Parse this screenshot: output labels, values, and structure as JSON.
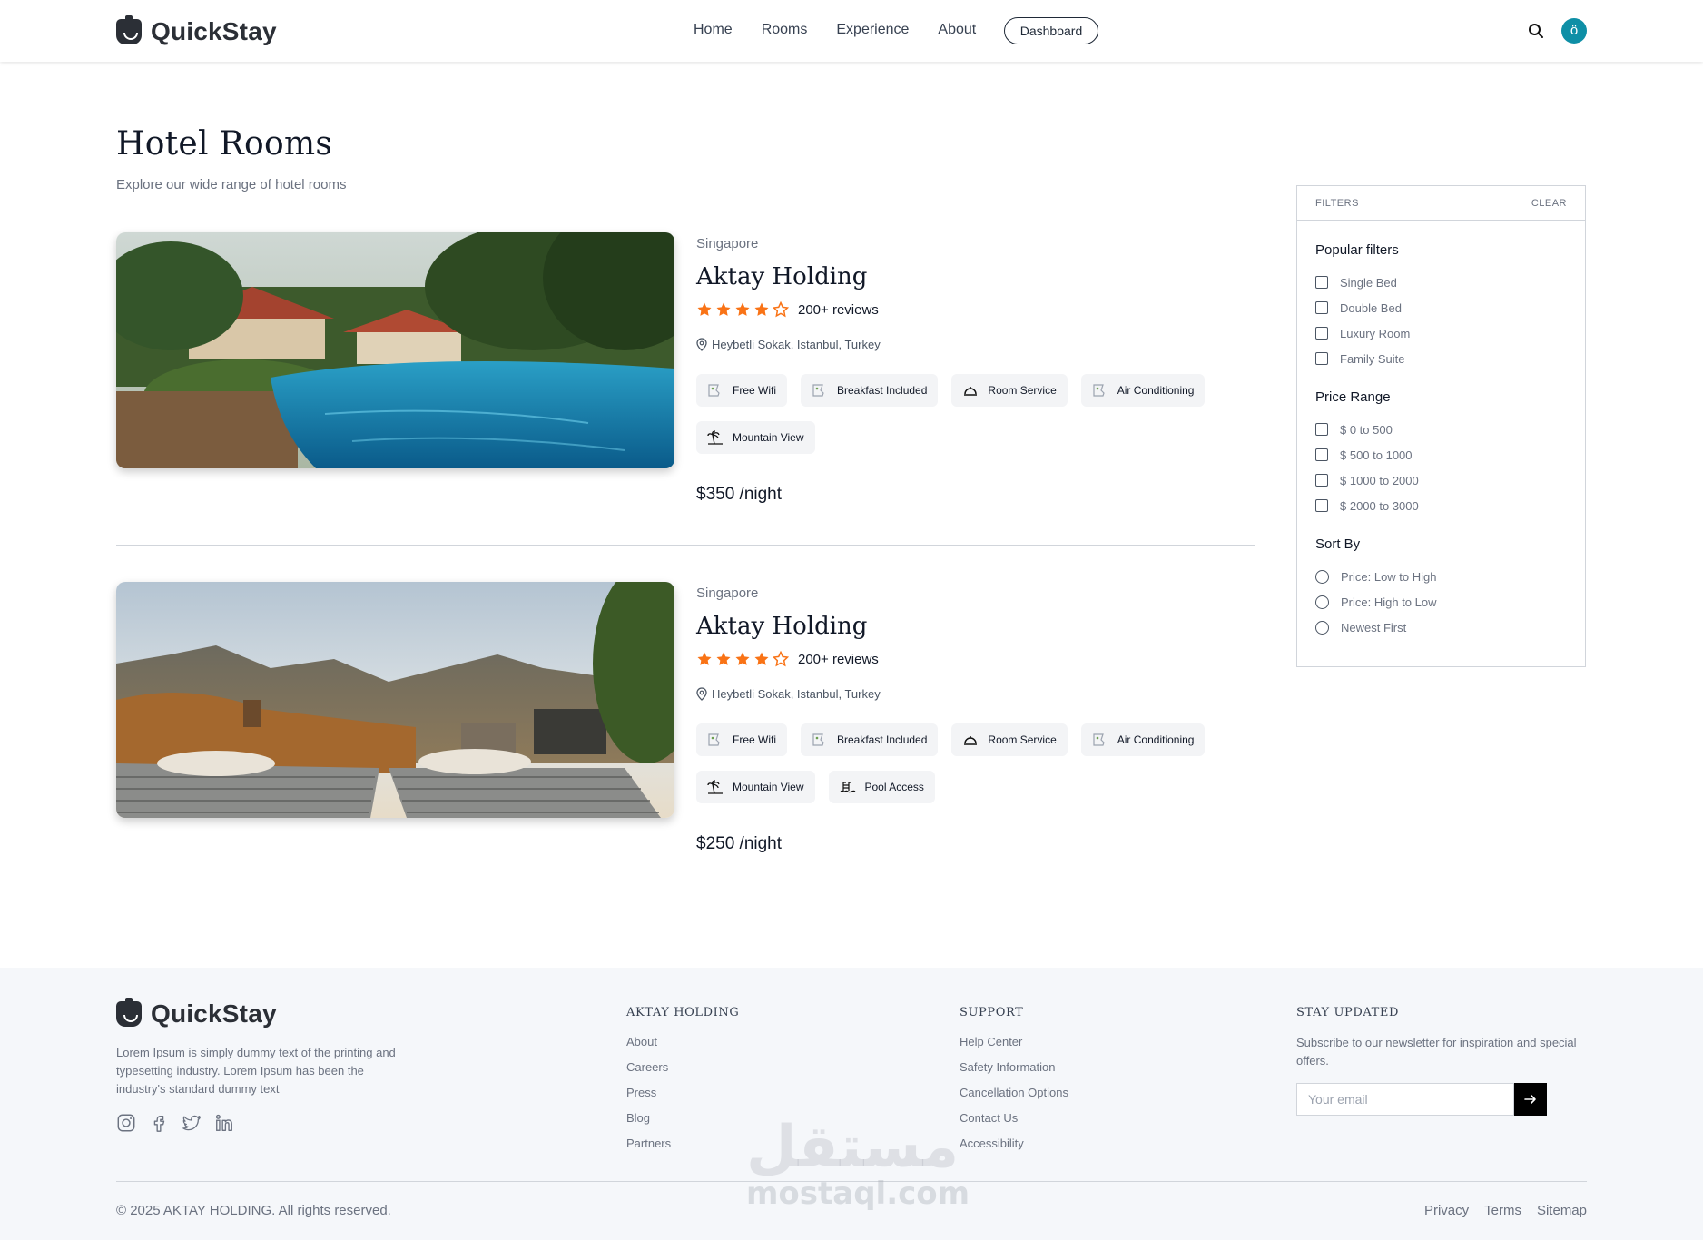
{
  "brand": {
    "name": "QuickStay"
  },
  "nav": {
    "links": [
      "Home",
      "Rooms",
      "Experience",
      "About"
    ],
    "dashboard_label": "Dashboard",
    "avatar_letter": "ö"
  },
  "page": {
    "title": "Hotel Rooms",
    "subtitle": "Explore our wide range of hotel rooms"
  },
  "rooms": [
    {
      "city": "Singapore",
      "name": "Aktay Holding",
      "rating": 4,
      "rating_max": 5,
      "reviews": "200+ reviews",
      "address": "Heybetli Sokak, Istanbul, Turkey",
      "amenities": [
        {
          "label": "Free Wifi",
          "icon": "broken-image-icon"
        },
        {
          "label": "Breakfast Included",
          "icon": "broken-image-icon"
        },
        {
          "label": "Room Service",
          "icon": "bell-icon"
        },
        {
          "label": "Air Conditioning",
          "icon": "broken-image-icon"
        },
        {
          "label": "Mountain View",
          "icon": "palm-tree-icon"
        }
      ],
      "price": "$350 /night",
      "image": "resort-pool-photo"
    },
    {
      "city": "Singapore",
      "name": "Aktay Holding",
      "rating": 4,
      "rating_max": 5,
      "reviews": "200+ reviews",
      "address": "Heybetli Sokak, Istanbul, Turkey",
      "amenities": [
        {
          "label": "Free Wifi",
          "icon": "broken-image-icon"
        },
        {
          "label": "Breakfast Included",
          "icon": "broken-image-icon"
        },
        {
          "label": "Room Service",
          "icon": "bell-icon"
        },
        {
          "label": "Air Conditioning",
          "icon": "broken-image-icon"
        },
        {
          "label": "Mountain View",
          "icon": "palm-tree-icon"
        },
        {
          "label": "Pool Access",
          "icon": "pool-icon"
        }
      ],
      "price": "$250 /night",
      "image": "mountain-sunbeds-photo"
    }
  ],
  "filters": {
    "heading": "FILTERS",
    "clear_label": "CLEAR",
    "popular": {
      "title": "Popular filters",
      "options": [
        "Single Bed",
        "Double Bed",
        "Luxury Room",
        "Family Suite"
      ]
    },
    "price": {
      "title": "Price Range",
      "options": [
        "$ 0 to 500",
        "$ 500 to 1000",
        "$ 1000 to 2000",
        "$ 2000 to 3000"
      ]
    },
    "sort": {
      "title": "Sort By",
      "options": [
        "Price: Low to High",
        "Price: High to Low",
        "Newest First"
      ]
    }
  },
  "footer": {
    "brand": "QuickStay",
    "description": "Lorem Ipsum is simply dummy text of the printing and typesetting industry. Lorem Ipsum has been the industry's standard dummy text",
    "socials": [
      "instagram-icon",
      "facebook-icon",
      "twitter-icon",
      "linkedin-icon"
    ],
    "columns": [
      {
        "title": "AKTAY HOLDING",
        "links": [
          "About",
          "Careers",
          "Press",
          "Blog",
          "Partners"
        ]
      },
      {
        "title": "SUPPORT",
        "links": [
          "Help Center",
          "Safety Information",
          "Cancellation Options",
          "Contact Us",
          "Accessibility"
        ]
      }
    ],
    "newsletter": {
      "title": "STAY UPDATED",
      "text": "Subscribe to our newsletter for inspiration and special offers.",
      "placeholder": "Your email"
    },
    "copyright": "© 2025 AKTAY HOLDING. All rights reserved.",
    "legal": [
      "Privacy",
      "Terms",
      "Sitemap"
    ]
  },
  "watermark": {
    "arabic": "مستقل",
    "latin": "mostaql.com"
  },
  "colors": {
    "star": "#f97316",
    "avatar": "#0e8fa6",
    "footer_bg": "#f5f7fa"
  }
}
